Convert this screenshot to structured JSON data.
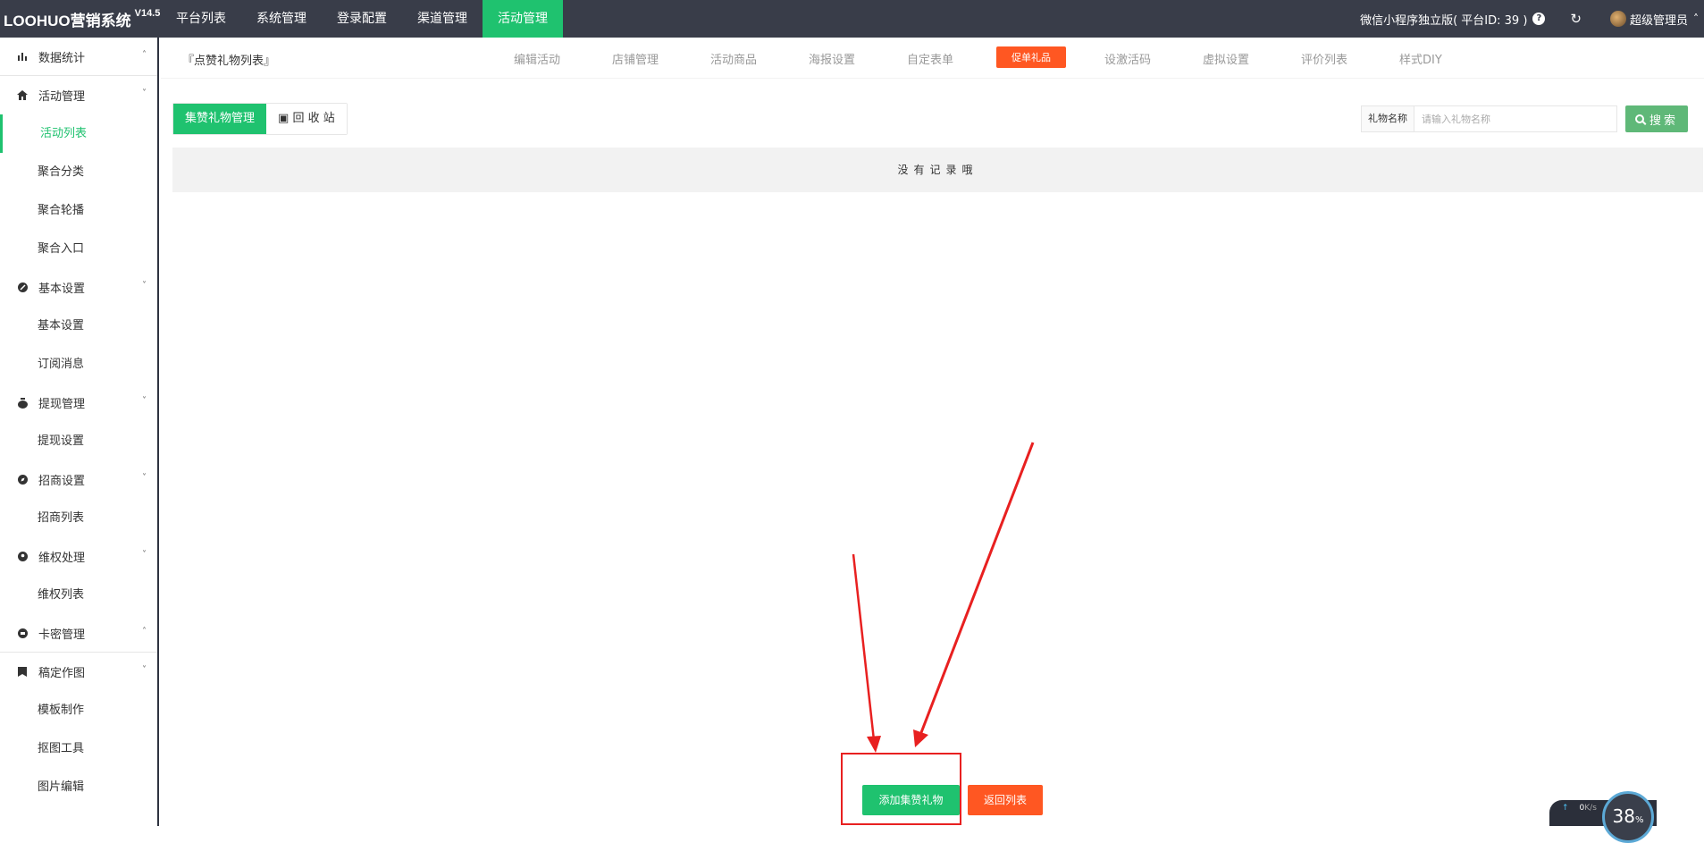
{
  "brand": {
    "name": "LOOHUO营销系统",
    "version": "V14.5"
  },
  "topnav": [
    {
      "label": "平台列表",
      "active": false
    },
    {
      "label": "系统管理",
      "active": false
    },
    {
      "label": "登录配置",
      "active": false
    },
    {
      "label": "渠道管理",
      "active": false
    },
    {
      "label": "活动管理",
      "active": true
    }
  ],
  "topright": {
    "platform": "微信小程序独立版( 平台ID: 39 )",
    "user": "超级管理员"
  },
  "sidebar": {
    "groups": [
      {
        "label": "数据统计",
        "icon": "bar-chart-icon",
        "caret": "^",
        "items": []
      },
      {
        "label": "活动管理",
        "icon": "home-icon",
        "caret": "v",
        "items": [
          {
            "label": "活动列表",
            "active": true
          },
          {
            "label": "聚合分类",
            "active": false
          },
          {
            "label": "聚合轮播",
            "active": false
          },
          {
            "label": "聚合入口",
            "active": false
          }
        ]
      },
      {
        "label": "基本设置",
        "icon": "settings-icon",
        "caret": "v",
        "items": [
          {
            "label": "基本设置",
            "active": false
          },
          {
            "label": "订阅消息",
            "active": false
          }
        ]
      },
      {
        "label": "提现管理",
        "icon": "money-bag-icon",
        "caret": "v",
        "items": [
          {
            "label": "提现设置",
            "active": false
          }
        ]
      },
      {
        "label": "招商设置",
        "icon": "compass-icon",
        "caret": "v",
        "items": [
          {
            "label": "招商列表",
            "active": false
          }
        ]
      },
      {
        "label": "维权处理",
        "icon": "user-circle-icon",
        "caret": "v",
        "items": [
          {
            "label": "维权列表",
            "active": false
          }
        ]
      },
      {
        "label": "卡密管理",
        "icon": "card-icon",
        "caret": "^",
        "items": []
      },
      {
        "label": "稿定作图",
        "icon": "bookmark-icon",
        "caret": "v",
        "items": [
          {
            "label": "模板制作",
            "active": false
          },
          {
            "label": "抠图工具",
            "active": false
          },
          {
            "label": "图片编辑",
            "active": false
          }
        ]
      }
    ]
  },
  "subhead": {
    "crumb": "『点赞礼物列表』",
    "tabs": [
      {
        "label": "编辑活动",
        "active": false
      },
      {
        "label": "店铺管理",
        "active": false
      },
      {
        "label": "活动商品",
        "active": false
      },
      {
        "label": "海报设置",
        "active": false
      },
      {
        "label": "自定表单",
        "active": false
      },
      {
        "label": "促单礼品",
        "active": true
      },
      {
        "label": "设激活码",
        "active": false
      },
      {
        "label": "虚拟设置",
        "active": false
      },
      {
        "label": "评价列表",
        "active": false
      },
      {
        "label": "样式DIY",
        "active": false
      }
    ]
  },
  "content": {
    "tab_manage": "集赞礼物管理",
    "tab_recycle": "回 收 站",
    "search_label": "礼物名称",
    "search_placeholder": "请输入礼物名称",
    "search_button": "搜索",
    "empty_text": "没有记录哦",
    "add_button": "添加集赞礼物",
    "back_button": "返回列表"
  },
  "net_widget": {
    "up": "0",
    "unit": "K/s",
    "percent": "38",
    "percent_unit": "%"
  }
}
